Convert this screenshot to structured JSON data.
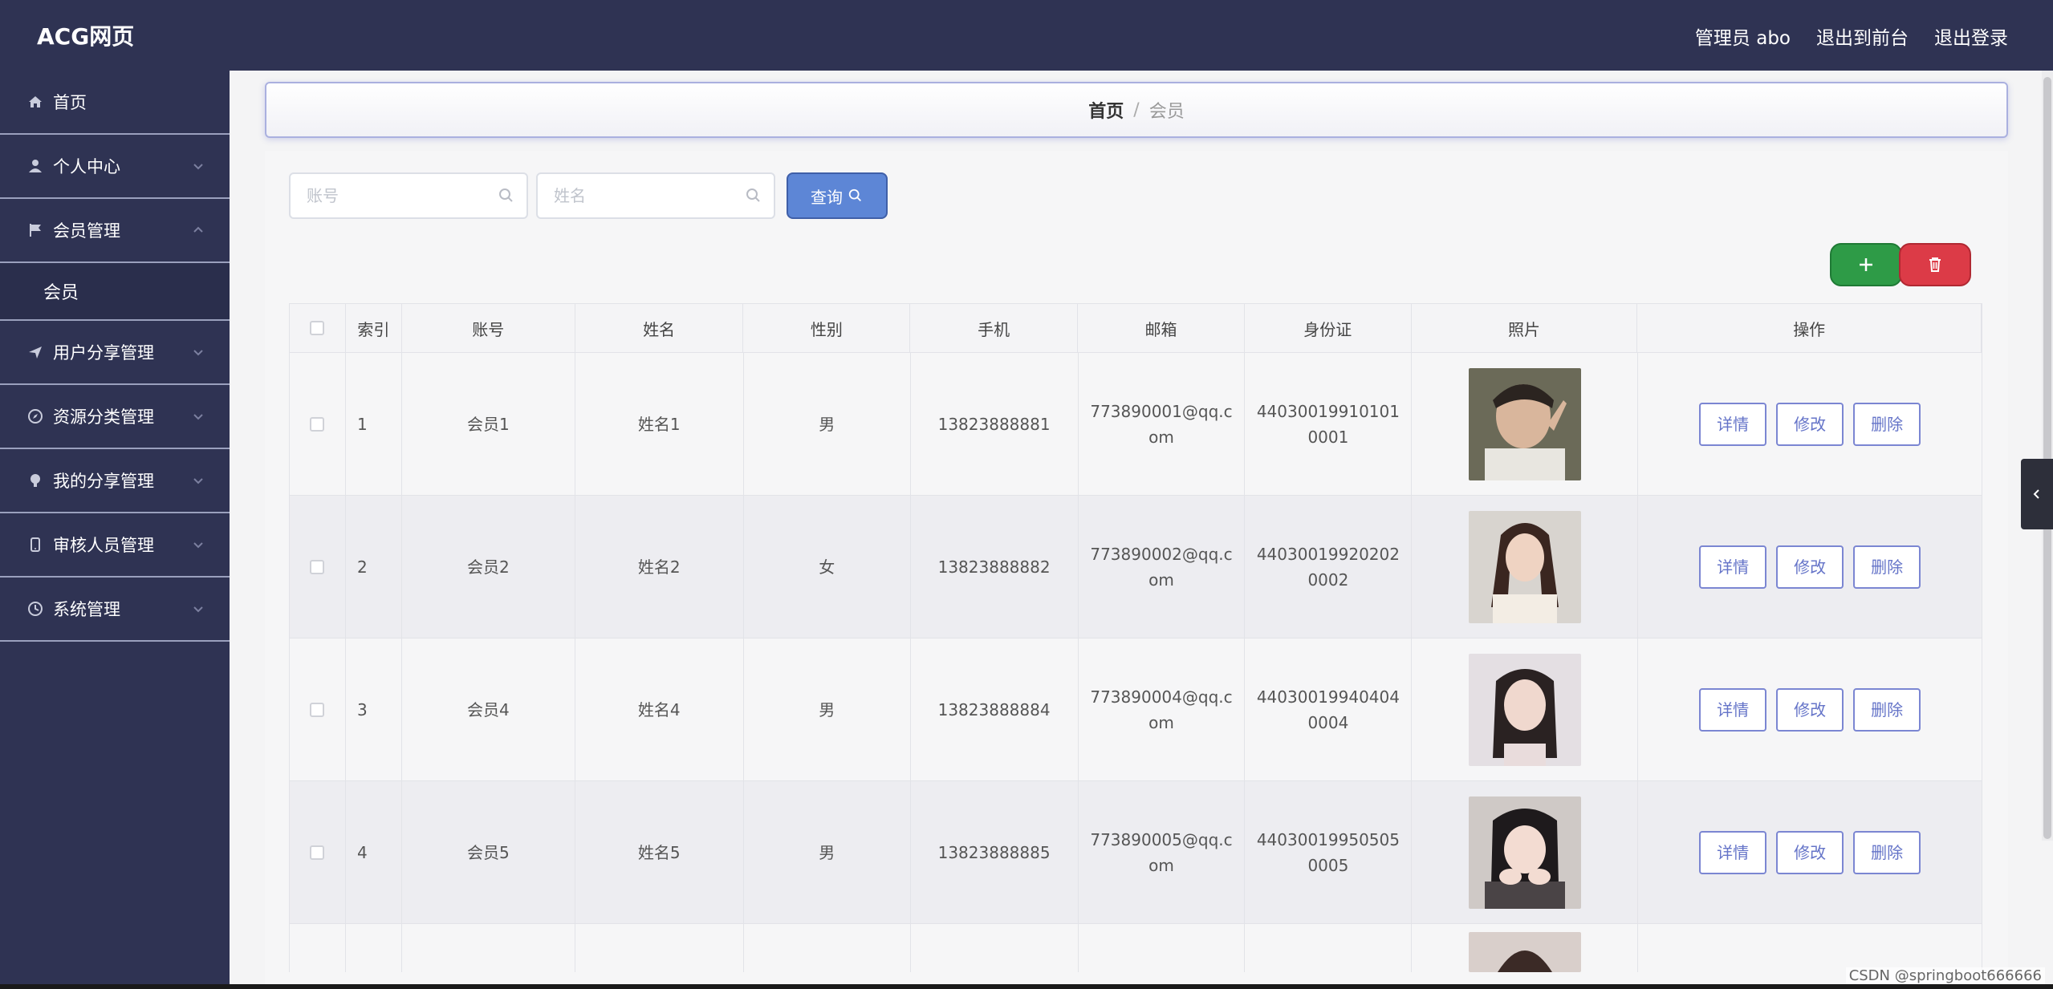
{
  "header": {
    "brand": "ACG网页",
    "admin_label": "管理员 abo",
    "to_frontend": "退出到前台",
    "logout": "退出登录"
  },
  "sidebar": {
    "items": [
      {
        "label": "首页",
        "icon": "home-icon"
      },
      {
        "label": "个人中心",
        "icon": "user-icon"
      },
      {
        "label": "会员管理",
        "icon": "flag-icon",
        "expanded": true,
        "sub": [
          "会员"
        ]
      },
      {
        "label": "用户分享管理",
        "icon": "send-icon"
      },
      {
        "label": "资源分类管理",
        "icon": "compass-icon"
      },
      {
        "label": "我的分享管理",
        "icon": "bulb-icon"
      },
      {
        "label": "审核人员管理",
        "icon": "mobile-icon"
      },
      {
        "label": "系统管理",
        "icon": "clock-icon"
      }
    ]
  },
  "breadcrumb": {
    "home": "首页",
    "separator": "/",
    "current": "会员"
  },
  "search": {
    "account_placeholder": "账号",
    "name_placeholder": "姓名",
    "query_label": "查询"
  },
  "table": {
    "headers": [
      "",
      "索引",
      "账号",
      "姓名",
      "性别",
      "手机",
      "邮箱",
      "身份证",
      "照片",
      "操作"
    ],
    "actions": {
      "detail": "详情",
      "edit": "修改",
      "delete": "删除"
    },
    "rows": [
      {
        "index": "1",
        "account": "会员1",
        "name": "姓名1",
        "sex": "男",
        "phone": "13823888881",
        "email": "773890001@qq.com",
        "idcard": "440300199101010001"
      },
      {
        "index": "2",
        "account": "会员2",
        "name": "姓名2",
        "sex": "女",
        "phone": "13823888882",
        "email": "773890002@qq.com",
        "idcard": "440300199202020002"
      },
      {
        "index": "3",
        "account": "会员4",
        "name": "姓名4",
        "sex": "男",
        "phone": "13823888884",
        "email": "773890004@qq.com",
        "idcard": "440300199404040004"
      },
      {
        "index": "4",
        "account": "会员5",
        "name": "姓名5",
        "sex": "男",
        "phone": "13823888885",
        "email": "773890005@qq.com",
        "idcard": "440300199505050005"
      }
    ]
  },
  "watermark": "CSDN @springboot666666",
  "colors": {
    "sidebar": "#2f3353",
    "accent": "#5d86d6",
    "add": "#2e9b47",
    "delete": "#dc3b47"
  }
}
